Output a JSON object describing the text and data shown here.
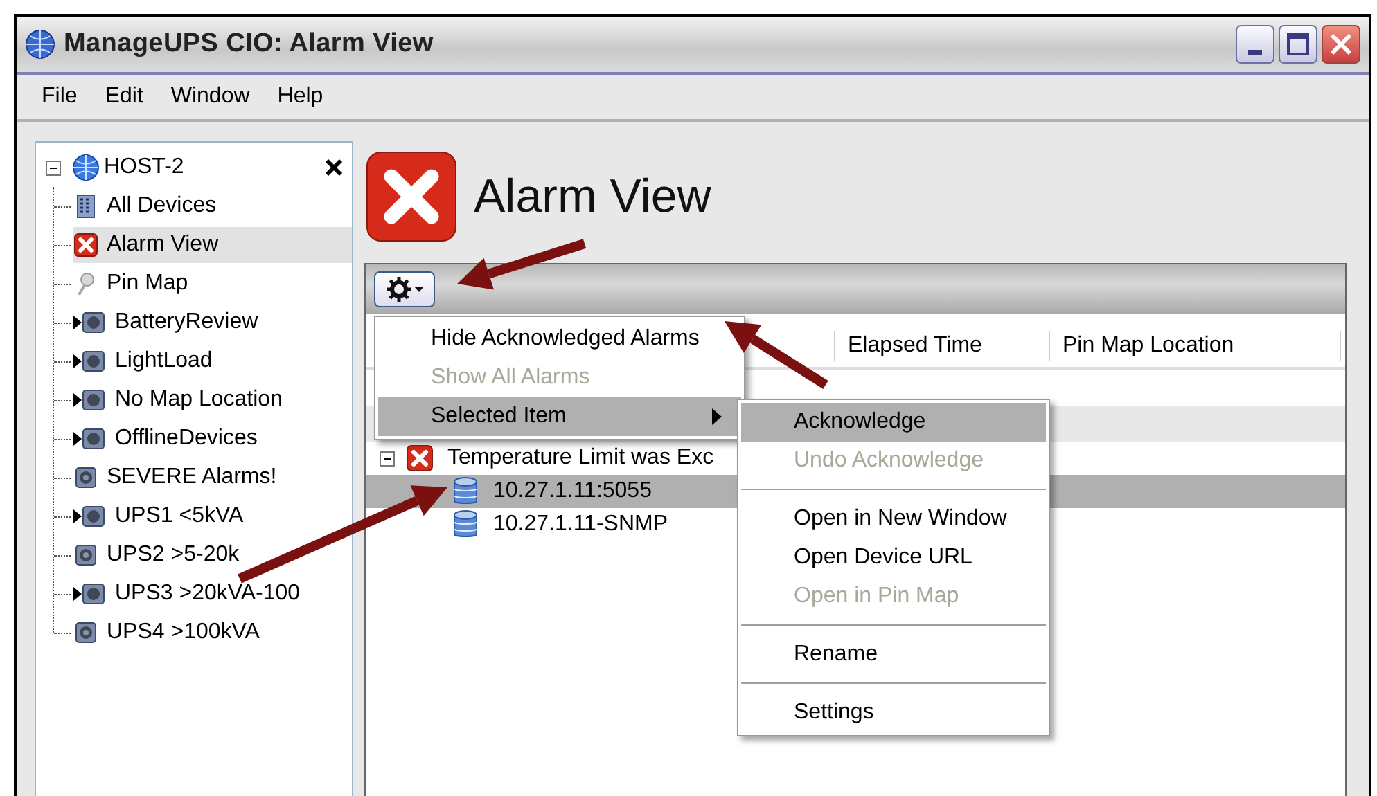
{
  "window": {
    "title": "ManageUPS CIO: Alarm View"
  },
  "menu_bar": [
    "File",
    "Edit",
    "Window",
    "Help"
  ],
  "tree": {
    "label": "HOST-2",
    "expanded": true,
    "children": [
      {
        "label": "All Devices",
        "kind": "devices",
        "selected": false
      },
      {
        "label": "Alarm View",
        "kind": "alarm",
        "selected": true
      },
      {
        "label": "Pin Map",
        "kind": "pin",
        "selected": false
      },
      {
        "label": "BatteryReview",
        "kind": "group",
        "selected": false
      },
      {
        "label": "LightLoad",
        "kind": "group",
        "selected": false
      },
      {
        "label": "No Map Location",
        "kind": "group",
        "selected": false
      },
      {
        "label": "OfflineDevices",
        "kind": "group",
        "selected": false
      },
      {
        "label": "SEVERE Alarms!",
        "kind": "view",
        "selected": false
      },
      {
        "label": "UPS1 <5kVA",
        "kind": "group",
        "selected": false
      },
      {
        "label": "UPS2 >5-20k",
        "kind": "view",
        "selected": false
      },
      {
        "label": "UPS3 >20kVA-100",
        "kind": "group",
        "selected": false
      },
      {
        "label": "UPS4 >100kVA",
        "kind": "view",
        "selected": false
      }
    ]
  },
  "header": {
    "title": "Alarm View"
  },
  "table": {
    "columns": [
      "Elapsed Time",
      "Pin Map Location"
    ],
    "rows": [
      {
        "label": "Temperature Limit was Exc",
        "expanded": true,
        "children": [
          {
            "label": "10.27.1.11:5055",
            "selected": true
          },
          {
            "label": "10.27.1.11-SNMP",
            "selected": false
          }
        ]
      }
    ]
  },
  "context_menu": {
    "items": [
      {
        "kind": "item",
        "label": "Hide Acknowledged Alarms",
        "disabled": false,
        "selected": false,
        "submenu": false
      },
      {
        "kind": "item",
        "label": "Show All Alarms",
        "disabled": true,
        "selected": false,
        "submenu": false
      },
      {
        "kind": "item",
        "label": "Selected Item",
        "disabled": false,
        "selected": true,
        "submenu": true
      }
    ]
  },
  "submenu": {
    "items": [
      {
        "kind": "item",
        "label": "Acknowledge",
        "disabled": false,
        "selected": true
      },
      {
        "kind": "item",
        "label": "Undo Acknowledge",
        "disabled": true,
        "selected": false
      },
      {
        "kind": "separator"
      },
      {
        "kind": "item",
        "label": "Open in New Window",
        "disabled": false,
        "selected": false
      },
      {
        "kind": "item",
        "label": "Open Device URL",
        "disabled": false,
        "selected": false
      },
      {
        "kind": "item",
        "label": "Open in Pin Map",
        "disabled": true,
        "selected": false
      },
      {
        "kind": "separator"
      },
      {
        "kind": "item",
        "label": "Rename",
        "disabled": false,
        "selected": false
      },
      {
        "kind": "separator"
      },
      {
        "kind": "item",
        "label": "Settings",
        "disabled": false,
        "selected": false
      }
    ]
  }
}
